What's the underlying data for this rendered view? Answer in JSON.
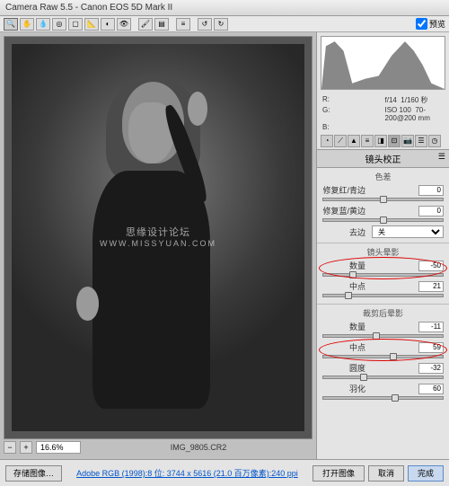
{
  "window": {
    "title": "Camera Raw 5.5 - Canon EOS 5D Mark II"
  },
  "toolbar": {
    "preview_checkbox_label": "预览"
  },
  "exif": {
    "r_label": "R:",
    "g_label": "G:",
    "b_label": "B:",
    "aperture": "f/14",
    "shutter": "1/160 秒",
    "iso_label": "ISO",
    "iso": "100",
    "lens": "70-200@200 mm"
  },
  "panel": {
    "title": "镜头校正"
  },
  "chromatic": {
    "title": "色差",
    "red_cyan_label": "修复红/青边",
    "red_cyan": "0",
    "blue_yellow_label": "修复蓝/黄边",
    "blue_yellow": "0",
    "defringe_label": "去边",
    "defringe_value": "关"
  },
  "vignette": {
    "title": "镜头晕影",
    "amount_label": "数量",
    "amount": "-50",
    "midpoint_label": "中点",
    "midpoint": "21"
  },
  "post_crop": {
    "title": "裁剪后晕影",
    "amount_label": "数量",
    "amount": "-11",
    "midpoint_label": "中点",
    "midpoint": "59",
    "roundness_label": "圆度",
    "roundness": "-32",
    "feather_label": "羽化",
    "feather": "60"
  },
  "preview": {
    "zoom": "16.6%",
    "filename": "IMG_9805.CR2",
    "watermark_main": "思缘设计论坛",
    "watermark_sub": "WWW.MISSYUAN.COM"
  },
  "footer": {
    "save": "存储图像…",
    "link": "Adobe RGB (1998):8 位: 3744 x 5616 (21.0 百万像素):240 ppi",
    "open": "打开图像",
    "cancel": "取消",
    "done": "完成"
  }
}
